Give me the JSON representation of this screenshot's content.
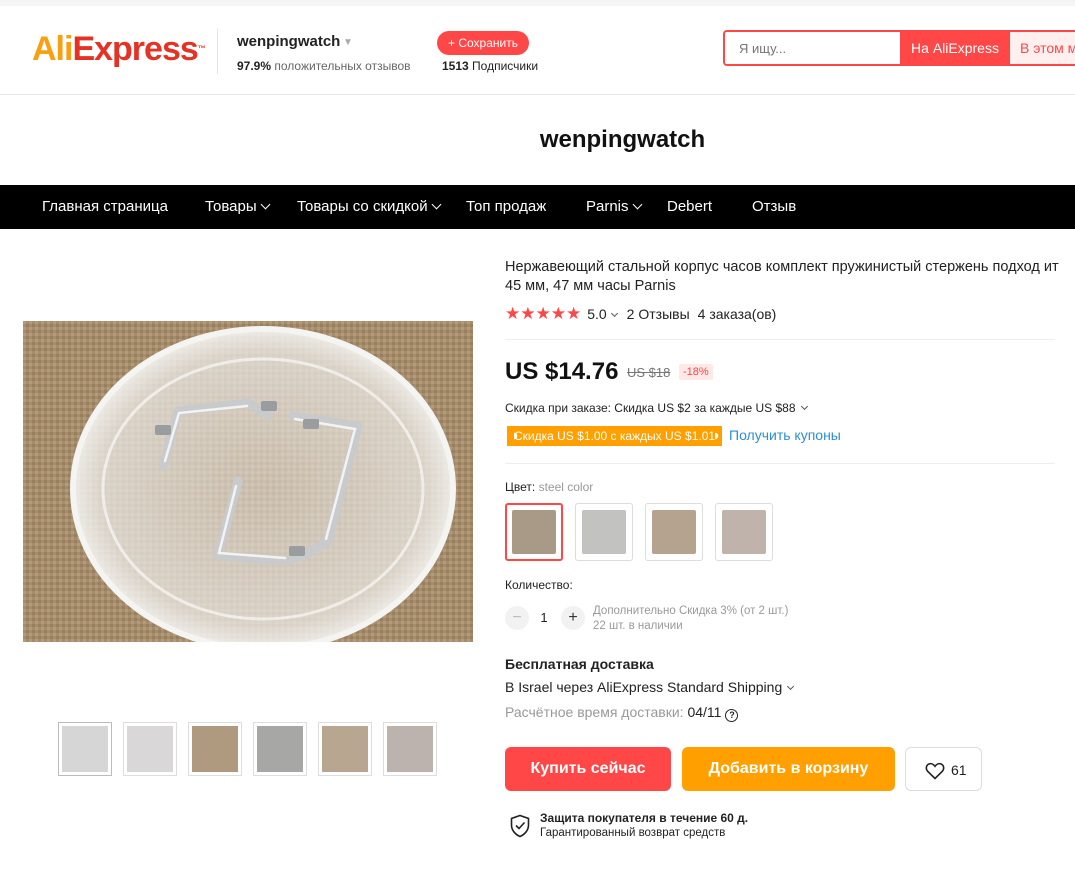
{
  "header": {
    "logo_ali": "Ali",
    "logo_express": "Express",
    "logo_tm": "™",
    "store_name": "wenpingwatch",
    "positive_percent": "97.9%",
    "positive_label": "положительных отзывов",
    "follow_label": "+ Сохранить",
    "followers_count": "1513",
    "followers_label": "Подписчики",
    "search_placeholder": "Я ищу...",
    "search_aliexpress": "На AliExpress",
    "search_store": "В этом м"
  },
  "store_title": "wenpingwatch",
  "nav": [
    {
      "label": "Главная страница",
      "dropdown": false
    },
    {
      "label": "Товары",
      "dropdown": true
    },
    {
      "label": "Товары со скидкой",
      "dropdown": true
    },
    {
      "label": "Топ продаж",
      "dropdown": false
    },
    {
      "label": "Parnis",
      "dropdown": true
    },
    {
      "label": "Debert",
      "dropdown": false
    },
    {
      "label": "Отзыв",
      "dropdown": false
    }
  ],
  "product": {
    "title": "Нержавеющий стальной корпус часов комплект пружинистый стержень подход ит 45 мм, 47 мм часы Parnis",
    "stars": "★★★★★",
    "rating": "5.0",
    "reviews": "2 Отзывы",
    "orders": "4 заказа(ов)",
    "price": "US $14.76",
    "old_price": "US $18",
    "discount": "-18%",
    "order_discount": "Скидка при заказе: Скидка US $2 за каждые US $88",
    "coupon": "Скидка US $1.00 с каждых US $1.01",
    "coupon_link": "Получить купоны",
    "color_label": "Цвет:",
    "color_value": "steel color",
    "swatch_count": 4,
    "selected_swatch": 0,
    "qty_label": "Количество:",
    "qty_minus": "−",
    "qty_plus": "+",
    "qty_value": "1",
    "qty_discount": "Дополнительно Скидка 3% (от 2 шт.)",
    "qty_stock": "22 шт. в наличии",
    "shipping_title": "Бесплатная доставка",
    "shipping_route": "В Israel через AliExpress Standard Shipping",
    "shipping_eta_label": "Расчётное время доставки:",
    "shipping_eta_value": "04/11",
    "help_icon": "?",
    "buy_label": "Купить сейчас",
    "cart_label": "Добавить в корзину",
    "wishlist_count": "61",
    "protection_title": "Защита покупателя в течение 60 д.",
    "protection_sub": "Гарантированный возврат средств"
  },
  "gallery": {
    "thumbnail_count": 6,
    "active_thumbnail": 0
  },
  "colors": {
    "accent": "#ff4747",
    "orange": "#ffa000",
    "link": "#2b8fd5",
    "nav_bg": "#000000"
  }
}
